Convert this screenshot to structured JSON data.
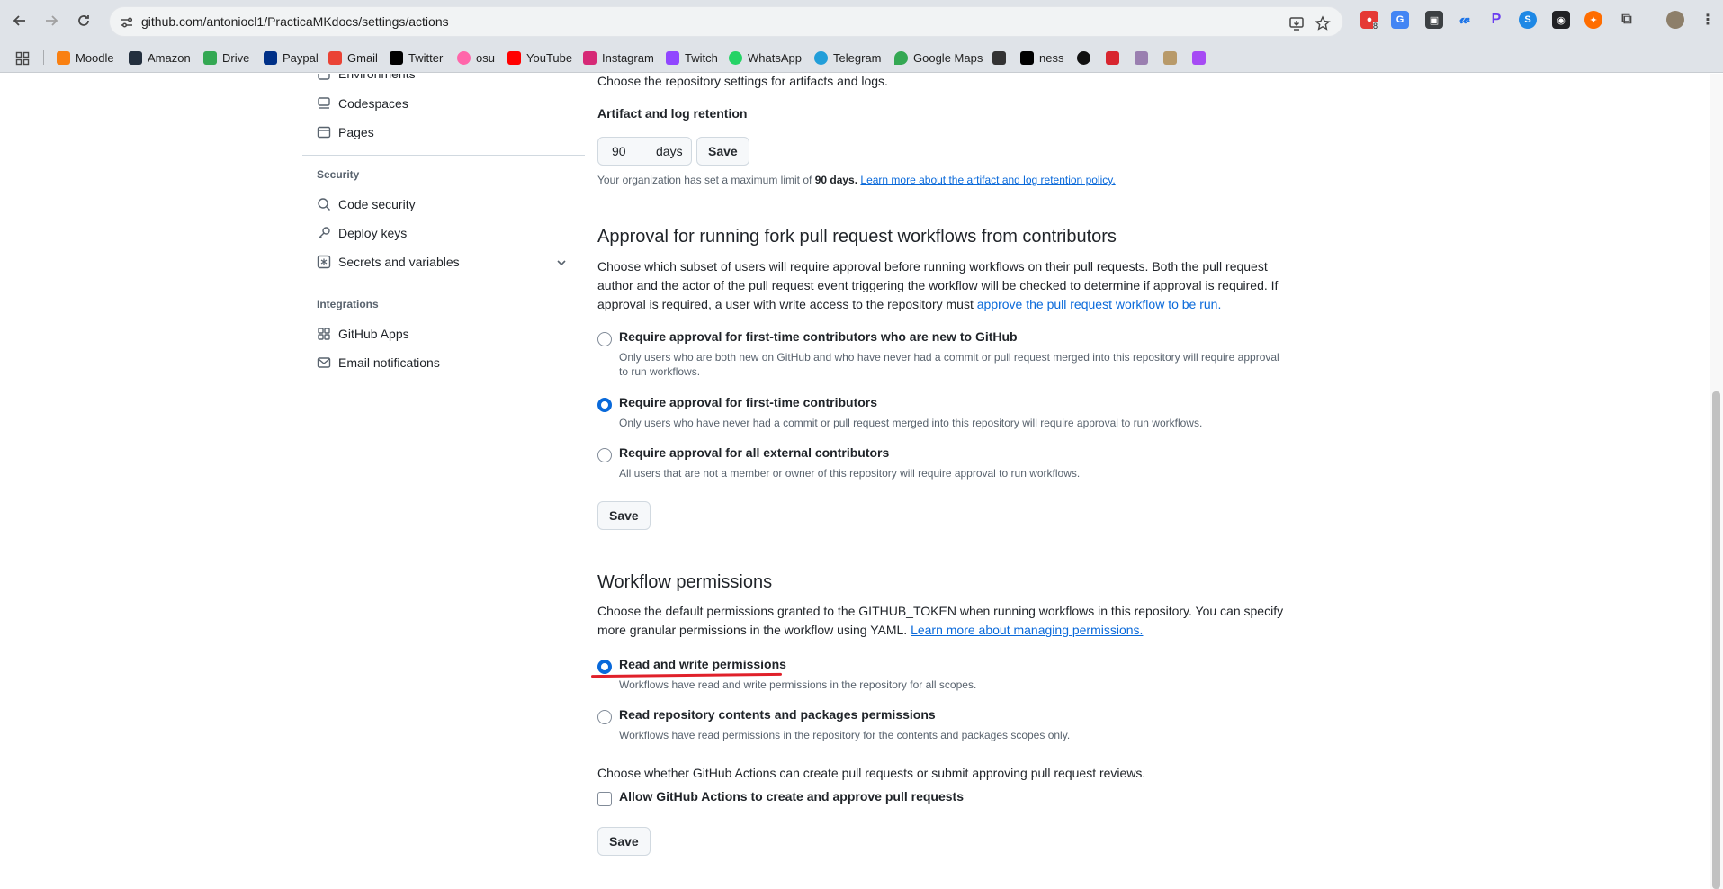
{
  "browser": {
    "url": "github.com/antoniocl1/PracticaMKdocs/settings/actions",
    "extension_badge": "8"
  },
  "bookmarks": [
    {
      "label": "Moodle",
      "icon": "moodle-icon",
      "color": "#f98012"
    },
    {
      "label": "Amazon",
      "icon": "amazon-icon",
      "color": "#232f3e"
    },
    {
      "label": "Drive",
      "icon": "drive-icon",
      "color": "#34a853"
    },
    {
      "label": "Paypal",
      "icon": "paypal-icon",
      "color": "#003087"
    },
    {
      "label": "Gmail",
      "icon": "gmail-icon",
      "color": "#ea4335"
    },
    {
      "label": "Twitter",
      "icon": "x-icon",
      "color": "#000000"
    },
    {
      "label": "osu",
      "icon": "osu-icon",
      "color": "#ff66aa"
    },
    {
      "label": "YouTube",
      "icon": "youtube-icon",
      "color": "#ff0000"
    },
    {
      "label": "Instagram",
      "icon": "instagram-icon",
      "color": "#d62976"
    },
    {
      "label": "Twitch",
      "icon": "twitch-icon",
      "color": "#9146ff"
    },
    {
      "label": "WhatsApp",
      "icon": "whatsapp-icon",
      "color": "#25d366"
    },
    {
      "label": "Telegram",
      "icon": "telegram-icon",
      "color": "#229ed9"
    },
    {
      "label": "Google Maps",
      "icon": "maps-icon",
      "color": "#34a853"
    },
    {
      "label": "ness",
      "icon": "wikipedia-icon",
      "color": "#000000"
    }
  ],
  "sidebar": {
    "top_items": [
      {
        "label": "Environments",
        "icon": "server-icon"
      },
      {
        "label": "Codespaces",
        "icon": "codespaces-icon"
      },
      {
        "label": "Pages",
        "icon": "browser-icon"
      }
    ],
    "security_heading": "Security",
    "security_items": [
      {
        "label": "Code security",
        "icon": "codescan-icon"
      },
      {
        "label": "Deploy keys",
        "icon": "key-icon"
      },
      {
        "label": "Secrets and variables",
        "icon": "key-asterisk-icon"
      }
    ],
    "integrations_heading": "Integrations",
    "integrations_items": [
      {
        "label": "GitHub Apps",
        "icon": "apps-icon"
      },
      {
        "label": "Email notifications",
        "icon": "mail-icon"
      }
    ]
  },
  "artifacts": {
    "intro": "Choose the repository settings for artifacts and logs.",
    "label": "Artifact and log retention",
    "value": "90",
    "unit": "days",
    "save": "Save",
    "note_prefix": "Your organization has set a maximum limit of",
    "note_limit": "90 days.",
    "note_link": "Learn more about the artifact and log retention policy."
  },
  "approval": {
    "title": "Approval for running fork pull request workflows from contributors",
    "desc": "Choose which subset of users will require approval before running workflows on their pull requests. Both the pull request author and the actor of the pull request event triggering the workflow will be checked to determine if approval is required. If approval is required, a user with write access to the repository must",
    "desc_link": "approve the pull request workflow to be run.",
    "options": [
      {
        "label": "Require approval for first-time contributors who are new to GitHub",
        "note": "Only users who are both new on GitHub and who have never had a commit or pull request merged into this repository will require approval to run workflows.",
        "selected": false
      },
      {
        "label": "Require approval for first-time contributors",
        "note": "Only users who have never had a commit or pull request merged into this repository will require approval to run workflows.",
        "selected": true
      },
      {
        "label": "Require approval for all external contributors",
        "note": "All users that are not a member or owner of this repository will require approval to run workflows.",
        "selected": false
      }
    ],
    "save": "Save"
  },
  "workflow": {
    "title": "Workflow permissions",
    "desc": "Choose the default permissions granted to the GITHUB_TOKEN when running workflows in this repository. You can specify more granular permissions in the workflow using YAML.",
    "desc_link": "Learn more about managing permissions.",
    "options": [
      {
        "label": "Read and write permissions",
        "note": "Workflows have read and write permissions in the repository for all scopes.",
        "selected": true
      },
      {
        "label": "Read repository contents and packages permissions",
        "note": "Workflows have read permissions in the repository for the contents and packages scopes only.",
        "selected": false
      }
    ],
    "pr_intro": "Choose whether GitHub Actions can create pull requests or submit approving pull request reviews.",
    "pr_checkbox": "Allow GitHub Actions to create and approve pull requests",
    "pr_checked": false,
    "save": "Save"
  }
}
